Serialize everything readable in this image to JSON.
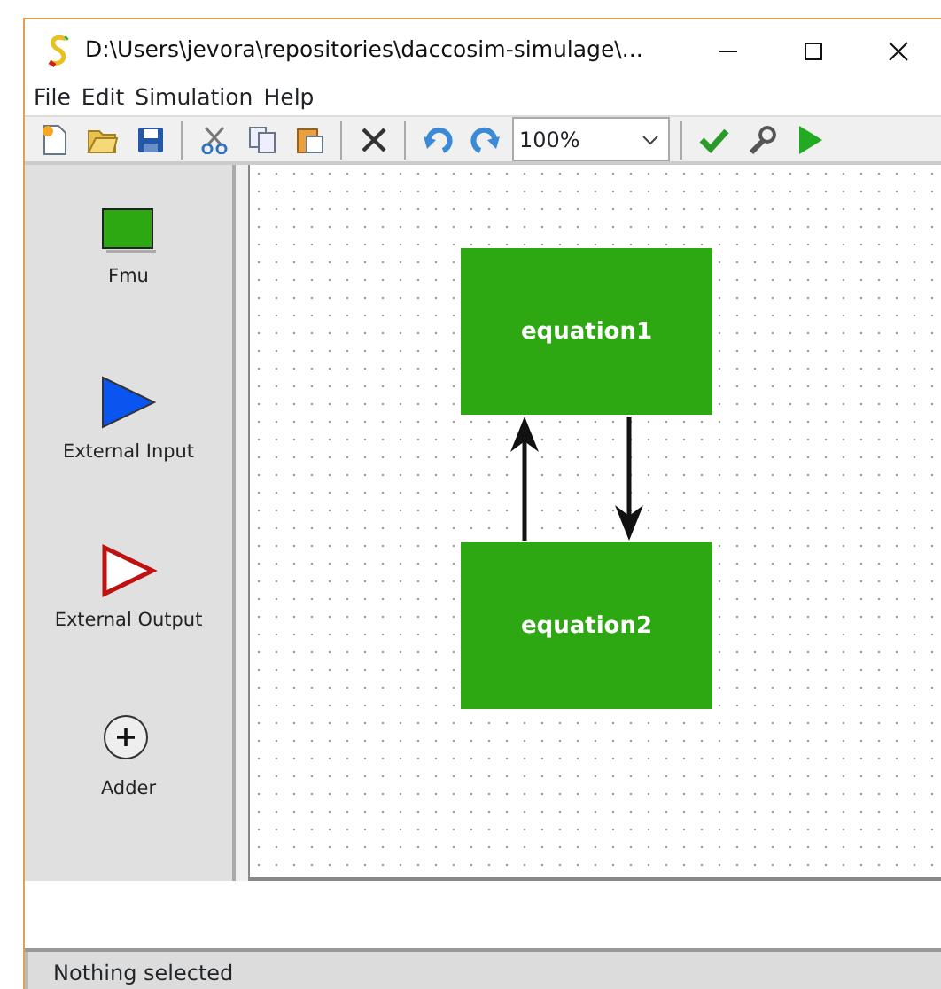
{
  "window": {
    "title": "D:\\Users\\jevora\\repositories\\daccosim-simulage\\..."
  },
  "menu": [
    "File",
    "Edit",
    "Simulation",
    "Help"
  ],
  "toolbar": {
    "zoom": "100%"
  },
  "palette": [
    {
      "kind": "fmu",
      "label": "Fmu"
    },
    {
      "kind": "input",
      "label": "External Input"
    },
    {
      "kind": "output",
      "label": "External Output"
    },
    {
      "kind": "adder",
      "label": "Adder"
    }
  ],
  "diagram": {
    "nodes": [
      {
        "label": "equation1"
      },
      {
        "label": "equation2"
      }
    ],
    "edges": [
      {
        "kind": "upward"
      },
      {
        "kind": "downward"
      }
    ]
  },
  "status_bar": "Nothing selected"
}
